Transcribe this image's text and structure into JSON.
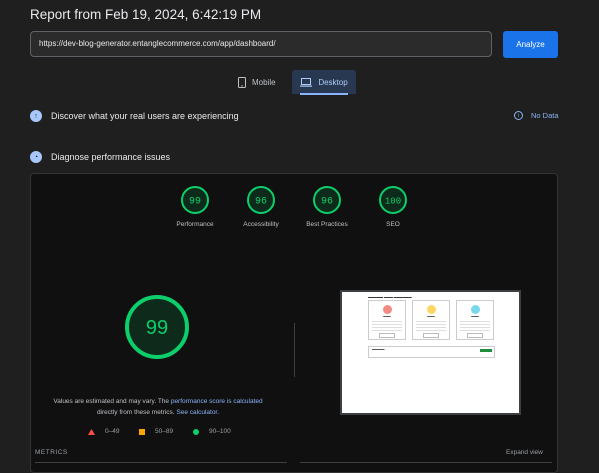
{
  "header": {
    "title": "Report from Feb 19, 2024, 6:42:19 PM"
  },
  "url_input": {
    "value": "https://dev-blog-generator.entanglecommerce.com/app/dashboard/"
  },
  "analyze_button": {
    "label": "Analyze"
  },
  "device_tabs": [
    {
      "label": "Mobile",
      "icon": "phone-icon",
      "selected": false
    },
    {
      "label": "Desktop",
      "icon": "laptop-icon",
      "selected": true
    }
  ],
  "sections": {
    "real_users": {
      "label": "Discover what your real users are experiencing",
      "status": "No Data"
    },
    "diagnose": {
      "label": "Diagnose performance issues"
    }
  },
  "scores": [
    {
      "value": "99",
      "label": "Performance"
    },
    {
      "value": "96",
      "label": "Accessibility"
    },
    {
      "value": "96",
      "label": "Best Practices"
    },
    {
      "value": "100",
      "label": "SEO"
    }
  ],
  "performance": {
    "score": "99",
    "note_prefix": "Values are estimated and may vary. The ",
    "note_link": "performance score is calculated",
    "note_middle": "directly from these metrics. ",
    "note_link2": "See calculator."
  },
  "legend": [
    {
      "range": "0–49",
      "shape": "triangle",
      "color": "#ff4e42"
    },
    {
      "range": "50–89",
      "shape": "square",
      "color": "#ffa400"
    },
    {
      "range": "90–100",
      "shape": "circle",
      "color": "#0cce6b"
    }
  ],
  "metrics": {
    "label": "METRICS",
    "expand": "Expand view"
  },
  "colors": {
    "accent": "#1a73e8",
    "good": "#0cce6b",
    "background": "#1f1f1f",
    "link": "#8ab4f8"
  }
}
